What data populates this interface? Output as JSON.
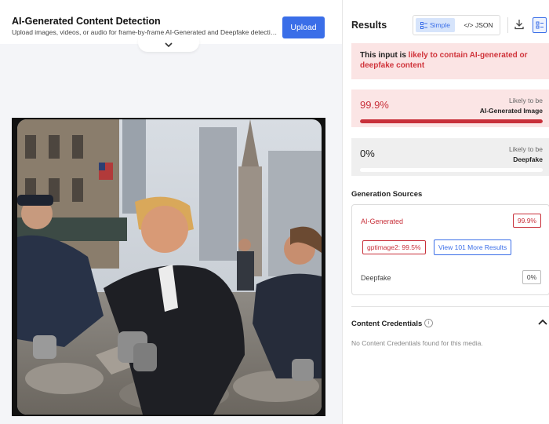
{
  "header": {
    "title": "AI-Generated Content Detection",
    "subtitle": "Upload images, videos, or audio for frame-by-frame AI-Generated and Deepfake detection with...",
    "upload_label": "Upload"
  },
  "results": {
    "title": "Results",
    "view_toggle": {
      "simple_label": "Simple",
      "json_label": "</> JSON",
      "selected": "Simple"
    },
    "alert": {
      "prefix": "This input is ",
      "highlight": "likely to contain AI-generated or deepfake content"
    },
    "scores": [
      {
        "value": "99.9%",
        "caption": "Likely to be",
        "label": "AI-Generated Image",
        "level": 0.999
      },
      {
        "value": "0%",
        "caption": "Likely to be",
        "label": "Deepfake",
        "level": 0.0
      }
    ],
    "generation_sources": {
      "title": "Generation Sources",
      "ai_label": "AI-Generated",
      "ai_score": "99.9%",
      "model_chip": "gptimage2: 99.5%",
      "more_label": "View 101 More Results",
      "deepfake_label": "Deepfake",
      "deepfake_score": "0%"
    },
    "content_credentials": {
      "title": "Content Credentials",
      "message": "No Content Credentials found for this media."
    }
  },
  "colors": {
    "accent": "#3a6ee8",
    "danger": "#d0343b",
    "alert_bg": "#fbe4e4"
  },
  "icons": [
    "chevron-down-icon",
    "simple-view-icon",
    "download-icon",
    "layout-icon",
    "info-icon",
    "chevron-up-icon"
  ]
}
